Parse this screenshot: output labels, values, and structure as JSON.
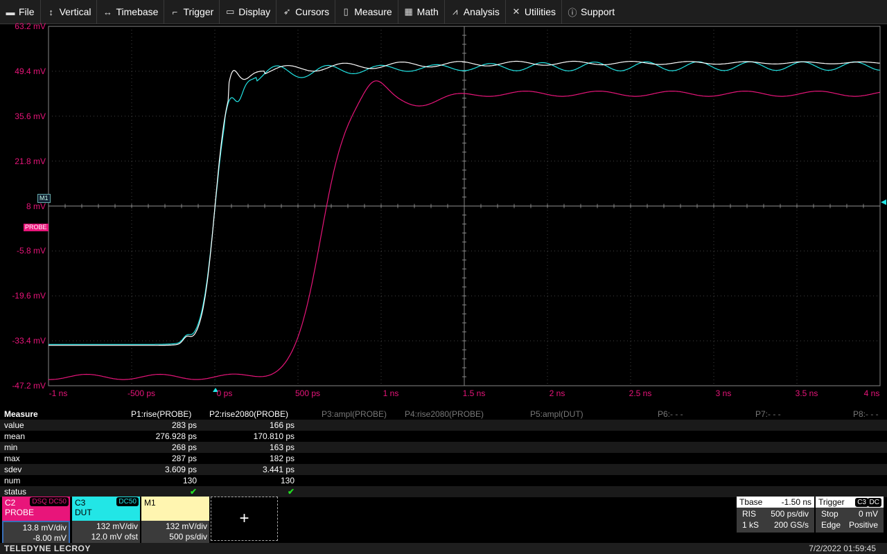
{
  "menu": [
    {
      "label": "File",
      "icon": "file-icon"
    },
    {
      "label": "Vertical",
      "icon": "vertical-arrows-icon"
    },
    {
      "label": "Timebase",
      "icon": "horizontal-arrows-icon"
    },
    {
      "label": "Trigger",
      "icon": "trigger-icon"
    },
    {
      "label": "Display",
      "icon": "display-icon"
    },
    {
      "label": "Cursors",
      "icon": "cursor-icon"
    },
    {
      "label": "Measure",
      "icon": "measure-icon"
    },
    {
      "label": "Math",
      "icon": "calculator-icon"
    },
    {
      "label": "Analysis",
      "icon": "analysis-chart-icon"
    },
    {
      "label": "Utilities",
      "icon": "tools-icon"
    },
    {
      "label": "Support",
      "icon": "info-icon"
    }
  ],
  "y_labels": [
    "63.2 mV",
    "49.4 mV",
    "35.6 mV",
    "21.8 mV",
    "8 mV",
    "-5.8 mV",
    "-19.6 mV",
    "-33.4 mV",
    "-47.2 mV"
  ],
  "x_labels": [
    "-1 ns",
    "-500 ps",
    "0 ps",
    "500 ps",
    "1 ns",
    "1.5 ns",
    "2 ns",
    "2.5 ns",
    "3 ns",
    "3.5 ns",
    "4 ns"
  ],
  "trace_tags": {
    "m1": "M1",
    "probe": "PROBE"
  },
  "colors": {
    "c2": "#e8157a",
    "c3": "#22e6e6",
    "m1": "#fff5b0",
    "grid": "#444444",
    "axis": "#888888"
  },
  "measure": {
    "header": "Measure",
    "params": [
      "P1:rise(PROBE)",
      "P2:rise2080(PROBE)",
      "P3:ampl(PROBE)",
      "P4:rise2080(PROBE)",
      "P5:ampl(DUT)",
      "P6:- - -",
      "P7:- - -",
      "P8:- - -"
    ],
    "rows": [
      {
        "label": "value",
        "p1": "283 ps",
        "p2": "166 ps"
      },
      {
        "label": "mean",
        "p1": "276.928 ps",
        "p2": "170.810 ps"
      },
      {
        "label": "min",
        "p1": "268 ps",
        "p2": "163 ps"
      },
      {
        "label": "max",
        "p1": "287 ps",
        "p2": "182 ps"
      },
      {
        "label": "sdev",
        "p1": "3.609 ps",
        "p2": "3.441 ps"
      },
      {
        "label": "num",
        "p1": "130",
        "p2": "130"
      },
      {
        "label": "status",
        "p1": "✔",
        "p2": "✔"
      }
    ]
  },
  "channels": {
    "c2": {
      "name": "C2",
      "label": "PROBE",
      "badge1": "DSQ",
      "badge2": "DC50",
      "scale": "13.8 mV/div",
      "offset": "-8.00 mV"
    },
    "c3": {
      "name": "C3",
      "label": "DUT",
      "badge1": "DC50",
      "scale": "132 mV/div",
      "offset": "12.0 mV ofst"
    },
    "m1": {
      "name": "M1",
      "scale": "132 mV/div",
      "offset": "500 ps/div"
    }
  },
  "add_button": "+",
  "timebase": {
    "title": "Tbase",
    "value": "-1.50 ns",
    "mode": "RIS",
    "div": "500 ps/div",
    "samples": "1 kS",
    "rate": "200 GS/s"
  },
  "trigger": {
    "title": "Trigger",
    "badge1": "C3",
    "badge2": "DC",
    "mode": "Stop",
    "level": "0 mV",
    "type": "Edge",
    "slope": "Positive"
  },
  "brand": "TELEDYNE LECROY",
  "clock": "7/2/2022 01:59:45"
}
